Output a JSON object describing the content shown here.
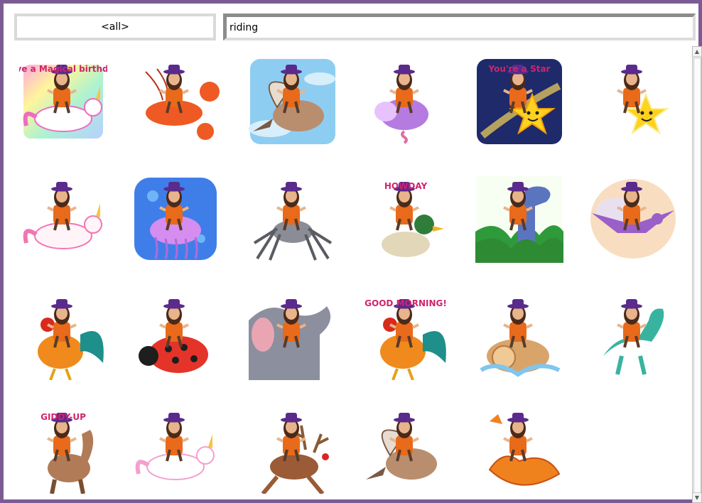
{
  "filter": {
    "category_label": "<all>",
    "search_value": "riding"
  },
  "stickers": [
    {
      "name": "magical-birthday-unicorn",
      "caption": "Have a Magical birthday!",
      "bg": "rainbow",
      "mount": "unicorn",
      "mount_color": "#ffffff",
      "accent": "#f06bc4"
    },
    {
      "name": "lobster",
      "caption": "",
      "bg": "none",
      "mount": "lobster",
      "mount_color": "#ef5a24",
      "accent": "#b6331a"
    },
    {
      "name": "sparrow-sky",
      "caption": "",
      "bg": "sky",
      "mount": "bird",
      "mount_color": "#b98e6e",
      "accent": "#e8dcd0"
    },
    {
      "name": "hippo-spring",
      "caption": "",
      "bg": "none",
      "mount": "hippo",
      "mount_color": "#b57be0",
      "accent": "#e7c2ff"
    },
    {
      "name": "youre-a-star",
      "caption": "You're a Star",
      "bg": "night",
      "mount": "star",
      "mount_color": "#ffd21f",
      "accent": "#f29e0c"
    },
    {
      "name": "shooting-star",
      "caption": "",
      "bg": "none",
      "mount": "star",
      "mount_color": "#ffd21f",
      "accent": "#f7ef9a"
    },
    {
      "name": "flying-unicorn-pink",
      "caption": "",
      "bg": "none",
      "mount": "unicorn",
      "mount_color": "#fff4f8",
      "accent": "#f176b2"
    },
    {
      "name": "jellyfish",
      "caption": "",
      "bg": "ocean",
      "mount": "jellyfish",
      "mount_color": "#d58df0",
      "accent": "#b36ad8"
    },
    {
      "name": "donkey-spider",
      "caption": "",
      "bg": "none",
      "mount": "spider",
      "mount_color": "#8a8d95",
      "accent": "#5a5c63"
    },
    {
      "name": "howday-duck",
      "caption": "HOWDAY",
      "bg": "none",
      "mount": "duck",
      "mount_color": "#e2d7b8",
      "accent": "#2f7d3b"
    },
    {
      "name": "brontosaurus",
      "caption": "",
      "bg": "jungle",
      "mount": "dino",
      "mount_color": "#5b74bf",
      "accent": "#2f8a34"
    },
    {
      "name": "pterodactyl",
      "caption": "",
      "bg": "sunset",
      "mount": "ptero",
      "mount_color": "#9a5fc8",
      "accent": "#e8a66b"
    },
    {
      "name": "rooster",
      "caption": "",
      "bg": "none",
      "mount": "rooster",
      "mount_color": "#f08a1c",
      "accent": "#1e8f8a"
    },
    {
      "name": "ladybug",
      "caption": "",
      "bg": "none",
      "mount": "ladybug",
      "mount_color": "#e4342a",
      "accent": "#1e1e1e"
    },
    {
      "name": "elephant",
      "caption": "",
      "bg": "none",
      "mount": "elephant",
      "mount_color": "#8c8f9e",
      "accent": "#e9a6b2"
    },
    {
      "name": "good-morning-rooster",
      "caption": "GOOD MORNING!",
      "bg": "none",
      "mount": "rooster",
      "mount_color": "#f08a1c",
      "accent": "#1e8f8a"
    },
    {
      "name": "log-rapids",
      "caption": "",
      "bg": "none",
      "mount": "log",
      "mount_color": "#d9a46a",
      "accent": "#7fc6f0"
    },
    {
      "name": "raptor",
      "caption": "",
      "bg": "none",
      "mount": "raptor",
      "mount_color": "#38b3a0",
      "accent": "#f1c9a8"
    },
    {
      "name": "giddy-up-horse",
      "caption": "GIDDY-UP",
      "bg": "none",
      "mount": "horse",
      "mount_color": "#b07b56",
      "accent": "#d2202a"
    },
    {
      "name": "flying-unicorn-white",
      "caption": "",
      "bg": "none",
      "mount": "unicorn",
      "mount_color": "#ffffff",
      "accent": "#f3a0cf"
    },
    {
      "name": "reindeer",
      "caption": "",
      "bg": "none",
      "mount": "reindeer",
      "mount_color": "#9a5b36",
      "accent": "#d82626"
    },
    {
      "name": "sparrow",
      "caption": "",
      "bg": "none",
      "mount": "bird",
      "mount_color": "#b98e6e",
      "accent": "#e8dcd0"
    },
    {
      "name": "autumn-leaf",
      "caption": "",
      "bg": "none",
      "mount": "leaf",
      "mount_color": "#f0821e",
      "accent": "#c94f12"
    }
  ],
  "colors": {
    "frame": "#7b5b94",
    "avatar_hat": "#5a2a8c",
    "avatar_shirt": "#e86a1a",
    "avatar_hair": "#4a2a1a",
    "avatar_skin": "#e8b48c"
  },
  "icons": {
    "scroll_up": "triangle-up-icon",
    "scroll_down": "triangle-down-icon"
  }
}
